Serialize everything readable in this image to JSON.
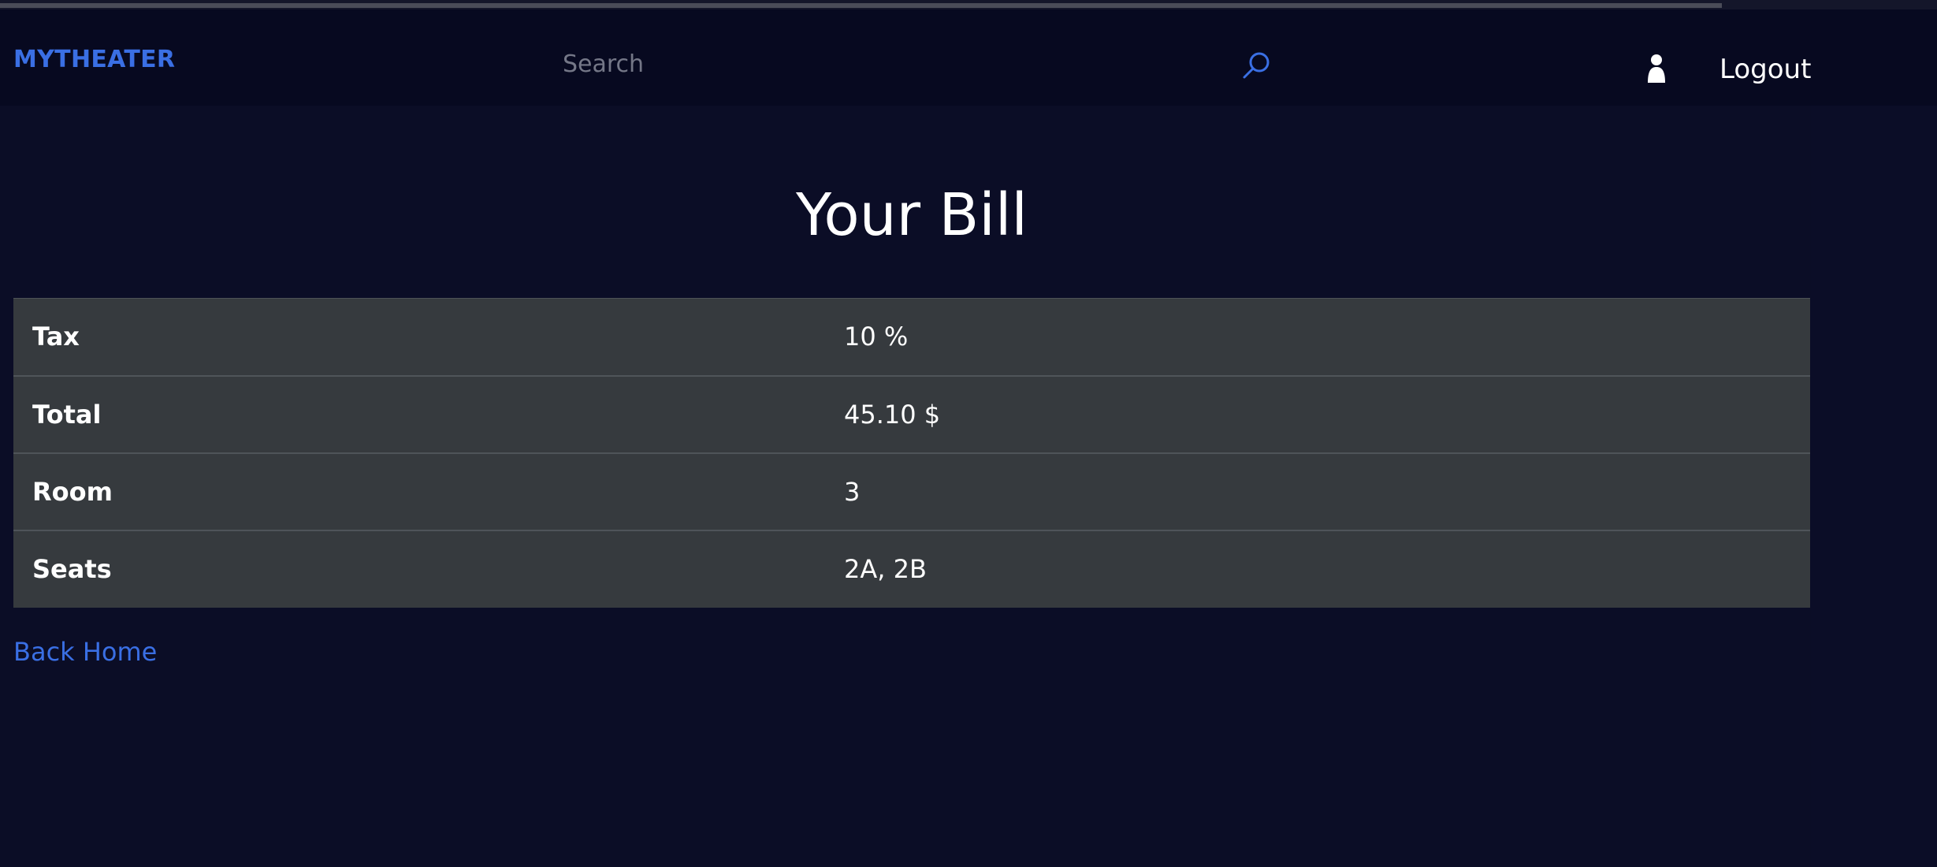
{
  "navbar": {
    "brand": "MYTHEATER",
    "search_placeholder": "Search",
    "logout_label": "Logout",
    "icons": [
      "search-icon",
      "user-icon"
    ]
  },
  "main": {
    "title": "Your Bill",
    "bill_rows": [
      {
        "label": "Tax",
        "value": "10 %"
      },
      {
        "label": "Total",
        "value": "45.10 $"
      },
      {
        "label": "Room",
        "value": "3"
      },
      {
        "label": "Seats",
        "value": "2A, 2B"
      }
    ],
    "back_link": "Back Home"
  },
  "colors": {
    "background": "#0b0d26",
    "navbar": "#070920",
    "accent": "#3a6fe4",
    "table_bg": "#363a3e",
    "text": "#ffffff"
  }
}
